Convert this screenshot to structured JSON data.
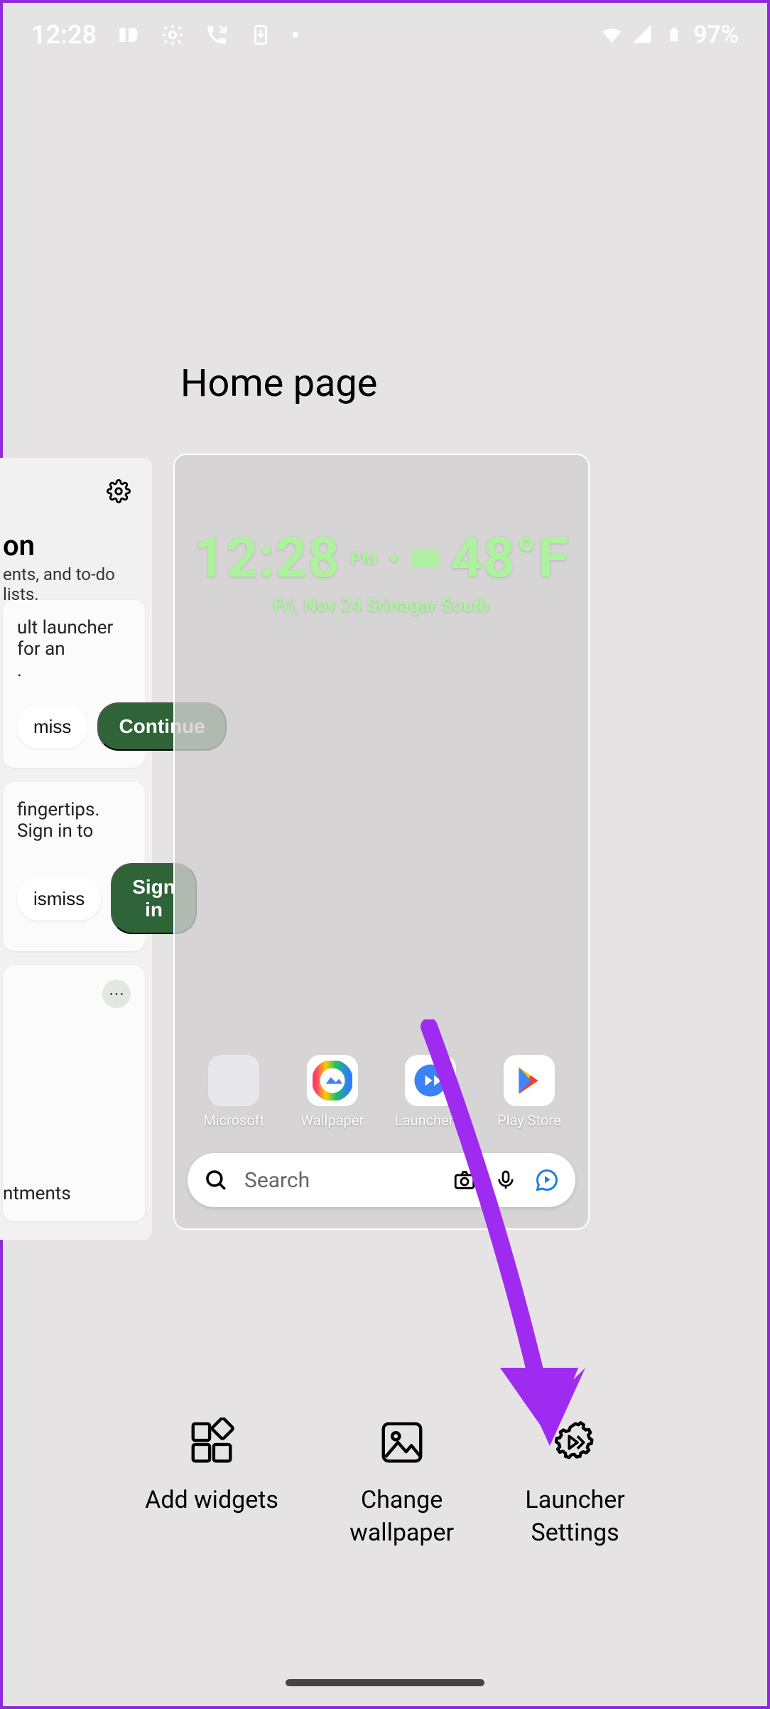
{
  "status": {
    "time": "12:28",
    "battery_text": "97%",
    "icons": [
      "id-icon",
      "gear-icon",
      "phone-incoming-icon",
      "download-icon",
      "dot-icon"
    ],
    "right_icons": [
      "wifi-icon",
      "signal-icon",
      "battery-icon"
    ]
  },
  "page_title": "Home page",
  "feed": {
    "title_fragment": "on",
    "subtitle_fragment": "ents, and to-do lists.",
    "card1": {
      "text_fragment": "ult launcher for an",
      "dismiss": "miss",
      "continue": "Continue"
    },
    "card2": {
      "text_fragment": "fingertips. Sign in to",
      "dismiss": "ismiss",
      "signin": "Sign in"
    },
    "card3": {
      "text_fragment": "ntments",
      "more_glyph": "⋯"
    }
  },
  "home": {
    "clock_time": "12:28",
    "clock_suffix": "PM",
    "temp": "48°F",
    "subline": "Fri, Nov 24  Srinagar South",
    "dock": [
      {
        "name": "Microsoft"
      },
      {
        "name": "Wallpaper"
      },
      {
        "name": "Launcher …"
      },
      {
        "name": "Play Store"
      }
    ],
    "search_placeholder": "Search"
  },
  "actions": {
    "widgets": "Add widgets",
    "wallpaper": "Change\nwallpaper",
    "settings": "Launcher\nSettings"
  },
  "colors": {
    "accent_purple": "#a02bf0",
    "button_green": "#2e6437",
    "clock_green": "#aef2a0"
  }
}
